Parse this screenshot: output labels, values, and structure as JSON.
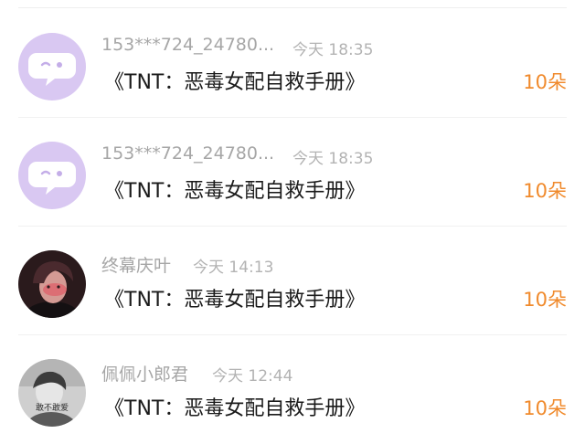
{
  "gifts": [
    {
      "name": "153***724_24780...",
      "time": "今天 18:35",
      "item": "《TNT：恶毒女配自救手册》",
      "amount": "10朵",
      "avatar": "default-chat-bubble"
    },
    {
      "name": "153***724_24780...",
      "time": "今天 18:35",
      "item": "《TNT：恶毒女配自救手册》",
      "amount": "10朵",
      "avatar": "default-chat-bubble"
    },
    {
      "name": "终幕庆叶",
      "time": "今天 14:13",
      "item": "《TNT：恶毒女配自救手册》",
      "amount": "10朵",
      "avatar": "user-photo"
    },
    {
      "name": "佩佩小郎君",
      "time": "今天 12:44",
      "item": "《TNT：恶毒女配自救手册》",
      "amount": "10朵",
      "avatar": "user-photo",
      "avatar_text": "敢不敢爱"
    }
  ],
  "colors": {
    "amount": "#f08a2c",
    "name": "#a6a6a6",
    "time": "#b3b3b3",
    "item": "#1a1a1a",
    "default_avatar_bg": "#d9c8f2"
  }
}
